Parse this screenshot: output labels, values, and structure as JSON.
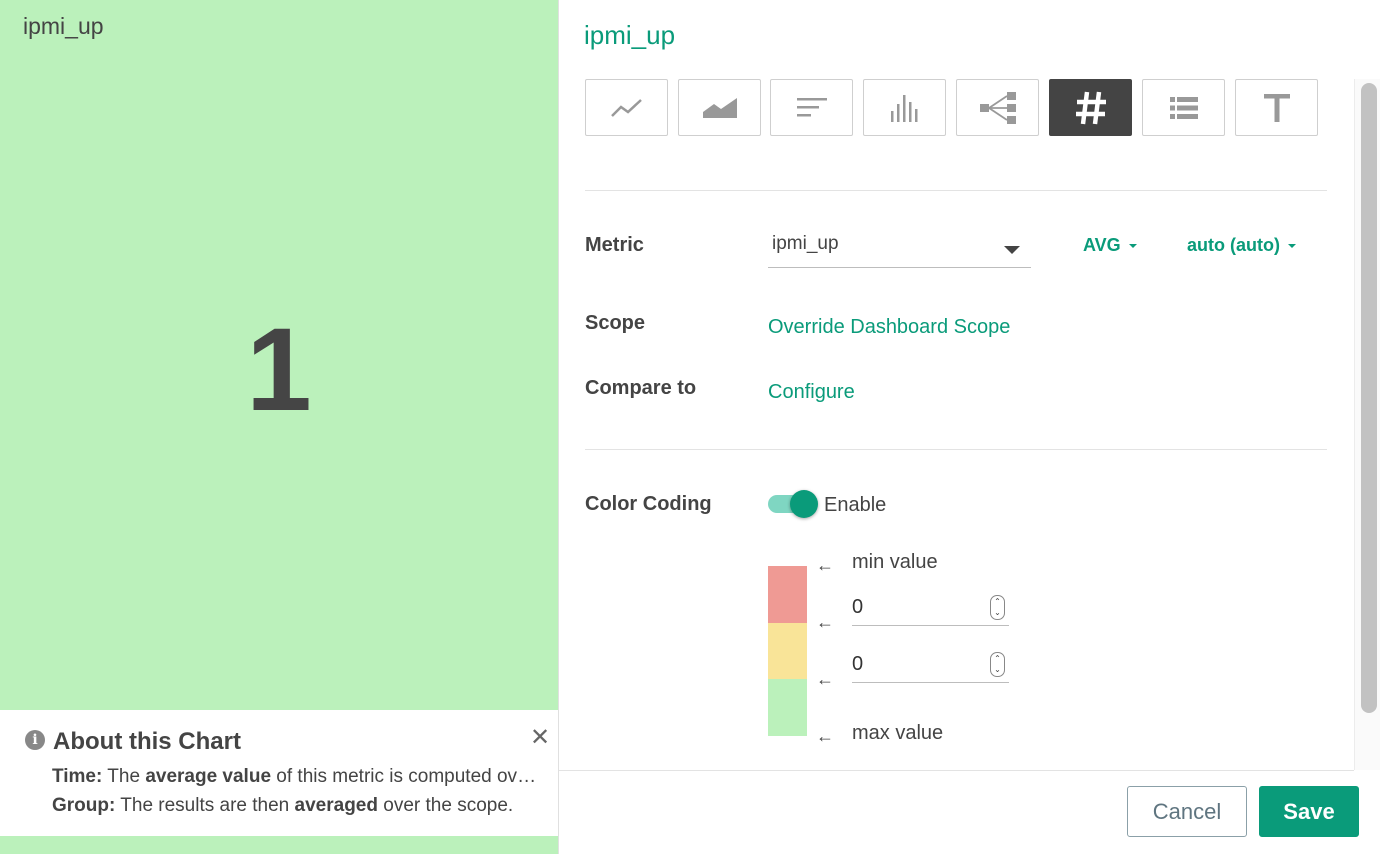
{
  "preview": {
    "title": "ipmi_up",
    "value": "1",
    "background_color": "#bbf1bb"
  },
  "about": {
    "icon": "info-icon",
    "title": "About this Chart",
    "close_icon": "close-icon",
    "time_label": "Time:",
    "time_pre": "The",
    "time_bold": "average value",
    "time_post": "of this metric is computed over the time interval.",
    "group_label": "Group:",
    "group_pre": "The results are then",
    "group_bold": "averaged",
    "group_post": "over the scope."
  },
  "panel": {
    "title": "ipmi_up",
    "accent_color": "#0a9b7a",
    "chart_types": [
      {
        "name": "line-chart",
        "icon": "line-chart-icon",
        "active": false
      },
      {
        "name": "area-chart",
        "icon": "area-chart-icon",
        "active": false
      },
      {
        "name": "top-list",
        "icon": "horizontal-bars-icon",
        "active": false
      },
      {
        "name": "histogram",
        "icon": "histogram-icon",
        "active": false
      },
      {
        "name": "topology",
        "icon": "topology-tree-icon",
        "active": false
      },
      {
        "name": "number",
        "icon": "hash-icon",
        "active": true
      },
      {
        "name": "table",
        "icon": "table-list-icon",
        "active": false
      },
      {
        "name": "text",
        "icon": "text-t-icon",
        "active": false
      }
    ]
  },
  "metric": {
    "label": "Metric",
    "value": "ipmi_up",
    "time_aggregation": "AVG",
    "resolution": "auto (auto)"
  },
  "scope": {
    "label": "Scope",
    "link": "Override Dashboard Scope"
  },
  "compare": {
    "label": "Compare to",
    "link": "Configure"
  },
  "color_coding": {
    "label": "Color Coding",
    "enabled": true,
    "toggle_label": "Enable",
    "min_label": "min value",
    "max_label": "max value",
    "threshold_1": "0",
    "threshold_2": "0",
    "arrow": "←",
    "colors": {
      "red": "#ef9a94",
      "yellow": "#f9e498",
      "green": "#bbf1bb"
    }
  },
  "footer": {
    "cancel": "Cancel",
    "save": "Save"
  }
}
